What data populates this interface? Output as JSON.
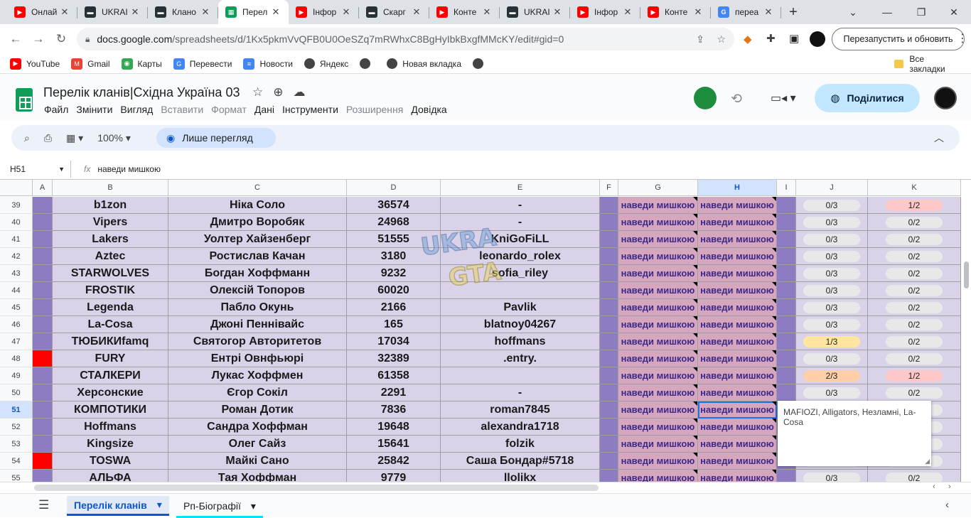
{
  "browser": {
    "tabs": [
      {
        "label": "Онлай",
        "fav": "yt",
        "favcolor": "#ff0000"
      },
      {
        "label": "UKRAI",
        "fav": "ua",
        "favcolor": "#263238"
      },
      {
        "label": "Клано",
        "fav": "ua",
        "favcolor": "#263238"
      },
      {
        "label": "Перел",
        "fav": "sheets",
        "favcolor": "#0f9d58"
      },
      {
        "label": "Інфор",
        "fav": "yt",
        "favcolor": "#ff0000"
      },
      {
        "label": "Скарг",
        "fav": "ua",
        "favcolor": "#263238"
      },
      {
        "label": "Конте",
        "fav": "yt",
        "favcolor": "#ff0000"
      },
      {
        "label": "UKRAI",
        "fav": "ua",
        "favcolor": "#263238"
      },
      {
        "label": "Інфор",
        "fav": "yt",
        "favcolor": "#ff0000"
      },
      {
        "label": "Конте",
        "fav": "yt",
        "favcolor": "#ff0000"
      },
      {
        "label": "переа",
        "fav": "google",
        "favcolor": "#4285f4"
      }
    ],
    "active_tab": 3,
    "url_host": "docs.google.com",
    "url_path": "/spreadsheets/d/1Kx5pkmVvQFB0U0OeSZq7mRWhxC8BgHyIbkBxgfMMcKY/edit#gid=0",
    "relaunch_label": "Перезапустить и обновить",
    "bookmarks": [
      {
        "label": "YouTube",
        "icon": "youtube-icon",
        "color": "#ff0000"
      },
      {
        "label": "Gmail",
        "icon": "gmail-icon",
        "color": "#ea4335"
      },
      {
        "label": "Карты",
        "icon": "maps-icon",
        "color": "#34a853"
      },
      {
        "label": "Перевести",
        "icon": "translate-icon",
        "color": "#4285f4"
      },
      {
        "label": "Новости",
        "icon": "news-icon",
        "color": "#4285f4"
      },
      {
        "label": "Яндекс",
        "icon": "globe-icon",
        "color": "#444444"
      },
      {
        "label": "",
        "icon": "globe-icon",
        "color": "#444444"
      },
      {
        "label": "Новая вкладка",
        "icon": "globe-icon",
        "color": "#444444"
      },
      {
        "label": "",
        "icon": "globe-icon",
        "color": "#444444"
      }
    ],
    "all_bookmarks": "Все закладки"
  },
  "doc": {
    "title": "Перелік кланів|Східна Україна 03",
    "menu": [
      {
        "label": "Файл",
        "disabled": false
      },
      {
        "label": "Змінити",
        "disabled": false
      },
      {
        "label": "Вигляд",
        "disabled": false
      },
      {
        "label": "Вставити",
        "disabled": true
      },
      {
        "label": "Формат",
        "disabled": true
      },
      {
        "label": "Дані",
        "disabled": false
      },
      {
        "label": "Інструменти",
        "disabled": false
      },
      {
        "label": "Розширення",
        "disabled": true
      },
      {
        "label": "Довідка",
        "disabled": false
      }
    ],
    "share_label": "Поділитися",
    "zoom": "100%",
    "view_only": "Лише перегляд"
  },
  "formula": {
    "cell_ref": "H51",
    "content": "наведи мишкою"
  },
  "columns": [
    "A",
    "B",
    "C",
    "D",
    "E",
    "F",
    "G",
    "H",
    "I",
    "J",
    "K"
  ],
  "selected_column": "H",
  "selected_row": "51",
  "rows": [
    {
      "n": "39",
      "a_red": false,
      "b": "b1zon",
      "c": "Ніка Соло",
      "d": "36574",
      "e": "-",
      "g": "наведи мишкою",
      "h": "наведи мишкою",
      "j": "0/3",
      "j_color": "gray",
      "k": "1/2",
      "k_color": "pink"
    },
    {
      "n": "40",
      "a_red": false,
      "b": "Vipers",
      "c": "Дмитро Воробяк",
      "d": "24968",
      "e": "-",
      "g": "наведи мишкою",
      "h": "наведи мишкою",
      "j": "0/3",
      "j_color": "gray",
      "k": "0/2",
      "k_color": "gray"
    },
    {
      "n": "41",
      "a_red": false,
      "b": "Lakers",
      "c": "Уолтер Хайзенберг",
      "d": "51555",
      "e": "KniGoFiLL",
      "g": "наведи мишкою",
      "h": "наведи мишкою",
      "j": "0/3",
      "j_color": "gray",
      "k": "0/2",
      "k_color": "gray"
    },
    {
      "n": "42",
      "a_red": false,
      "b": "Aztec",
      "c": "Ростислав Качан",
      "d": "3180",
      "e": "leonardo_rolex",
      "g": "наведи мишкою",
      "h": "наведи мишкою",
      "j": "0/3",
      "j_color": "gray",
      "k": "0/2",
      "k_color": "gray"
    },
    {
      "n": "43",
      "a_red": false,
      "b": "STARWOLVES",
      "c": "Богдан Хоффманн",
      "d": "9232",
      "e": "sofia_riley",
      "g": "наведи мишкою",
      "h": "наведи мишкою",
      "j": "0/3",
      "j_color": "gray",
      "k": "0/2",
      "k_color": "gray"
    },
    {
      "n": "44",
      "a_red": false,
      "b": "FROSTIK",
      "c": "Олексій Топоров",
      "d": "60020",
      "e": "",
      "g": "наведи мишкою",
      "h": "наведи мишкою",
      "j": "0/3",
      "j_color": "gray",
      "k": "0/2",
      "k_color": "gray"
    },
    {
      "n": "45",
      "a_red": false,
      "b": "Legenda",
      "c": "Пабло Окунь",
      "d": "2166",
      "e": "Pavlik",
      "g": "наведи мишкою",
      "h": "наведи мишкою",
      "j": "0/3",
      "j_color": "gray",
      "k": "0/2",
      "k_color": "gray"
    },
    {
      "n": "46",
      "a_red": false,
      "b": "La-Cosa",
      "c": "Джоні Пеннівайс",
      "d": "165",
      "e": "blatnoy04267",
      "g": "наведи мишкою",
      "h": "наведи мишкою",
      "j": "0/3",
      "j_color": "gray",
      "k": "0/2",
      "k_color": "gray"
    },
    {
      "n": "47",
      "a_red": false,
      "b": "ТЮБИКИfamq",
      "c": "Святогор Авторитетов",
      "d": "17034",
      "e": "hoffmans",
      "g": "наведи мишкою",
      "h": "наведи мишкою",
      "j": "1/3",
      "j_color": "yellow",
      "k": "0/2",
      "k_color": "gray"
    },
    {
      "n": "48",
      "a_red": true,
      "b": "FURY",
      "c": "Ентрі Овнфьюрі",
      "d": "32389",
      "e": ".entry.",
      "g": "наведи мишкою",
      "h": "наведи мишкою",
      "j": "0/3",
      "j_color": "gray",
      "k": "0/2",
      "k_color": "gray"
    },
    {
      "n": "49",
      "a_red": false,
      "b": "СТАЛКЕРИ",
      "c": "Лукас Хоффмен",
      "d": "61358",
      "e": "",
      "g": "наведи мишкою",
      "h": "наведи мишкою",
      "j": "2/3",
      "j_color": "orange",
      "k": "1/2",
      "k_color": "pink"
    },
    {
      "n": "50",
      "a_red": false,
      "b": "Херсонские",
      "c": "Єгор Сокіл",
      "d": "2291",
      "e": "-",
      "g": "наведи мишкою",
      "h": "наведи мишкою",
      "j": "0/3",
      "j_color": "gray",
      "k": "0/2",
      "k_color": "gray"
    },
    {
      "n": "51",
      "a_red": false,
      "b": "КОМПОТИКИ",
      "c": "Роман Дотик",
      "d": "7836",
      "e": "roman7845",
      "g": "наведи мишкою",
      "h": "наведи мишкою",
      "j": "",
      "j_color": "gray",
      "k": "",
      "k_color": "gray"
    },
    {
      "n": "52",
      "a_red": false,
      "b": "Hoffmans",
      "c": "Сандра Хоффман",
      "d": "19648",
      "e": "alexandra1718",
      "g": "наведи мишкою",
      "h": "наведи мишкою",
      "j": "",
      "j_color": "gray",
      "k": "",
      "k_color": "gray"
    },
    {
      "n": "53",
      "a_red": false,
      "b": "Kingsize",
      "c": "Олег Сайз",
      "d": "15641",
      "e": "folzik",
      "g": "наведи мишкою",
      "h": "наведи мишкою",
      "j": "",
      "j_color": "gray",
      "k": "",
      "k_color": "gray"
    },
    {
      "n": "54",
      "a_red": true,
      "b": "TOSWA",
      "c": "Майкі Сано",
      "d": "25842",
      "e": "Саша Бондар#5718",
      "g": "наведи мишкою",
      "h": "наведи мишкою",
      "j": "",
      "j_color": "gray",
      "k": "",
      "k_color": "gray"
    },
    {
      "n": "55",
      "a_red": false,
      "b": "АЛЬФА",
      "c": "Тая Хоффман",
      "d": "9779",
      "e": "llolikx",
      "g": "наведи мишкою",
      "h": "наведи мишкою",
      "j": "0/3",
      "j_color": "gray",
      "k": "0/2",
      "k_color": "gray"
    }
  ],
  "note": "MAFIOZI, Alligators, Незламні, La-Cosa",
  "watermark": "UKRAINE GTA",
  "sheets": [
    {
      "label": "Перелік кланів",
      "active": true
    },
    {
      "label": "Рп-Біографії",
      "active": false
    }
  ]
}
